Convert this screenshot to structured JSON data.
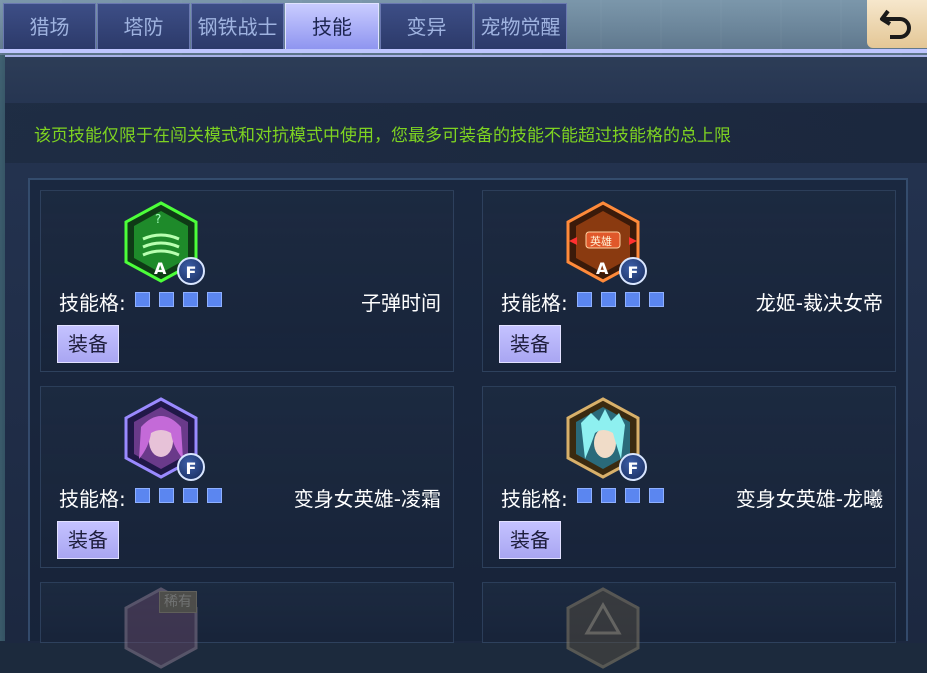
{
  "tabs": [
    {
      "label": "猎场",
      "active": false
    },
    {
      "label": "塔防",
      "active": false
    },
    {
      "label": "钢铁战士",
      "active": false
    },
    {
      "label": "技能",
      "active": true
    },
    {
      "label": "变异",
      "active": false
    },
    {
      "label": "宠物觉醒",
      "active": false
    }
  ],
  "notice": "该页技能仅限于在闯关模式和对抗模式中使用，您最多可装备的技能不能超过技能格的总上限",
  "slot_label": "技能格:",
  "equip_label": "装备",
  "badge_letter": "F",
  "skills": [
    {
      "name": "子弹时间",
      "slots": 4,
      "icon": "bullet-time-skill-icon",
      "grade": "A"
    },
    {
      "name": "龙姬-裁决女帝",
      "slots": 4,
      "icon": "dragon-princess-hero-icon",
      "grade": "A",
      "tag": "英雄"
    },
    {
      "name": "变身女英雄-凌霜",
      "slots": 4,
      "icon": "lingshuang-hero-portrait-icon"
    },
    {
      "name": "变身女英雄-龙曦",
      "slots": 4,
      "icon": "longxi-hero-portrait-icon"
    }
  ],
  "partial_cards": [
    {
      "tag": "稀有",
      "icon": "rare-skill-icon"
    },
    {
      "icon": "hero-skill-icon"
    }
  ],
  "colors": {
    "notice": "#7ed321",
    "tab_active": "#b6b9ff",
    "equip_button": "#b7b5fa",
    "slot": "#5b86f0"
  }
}
